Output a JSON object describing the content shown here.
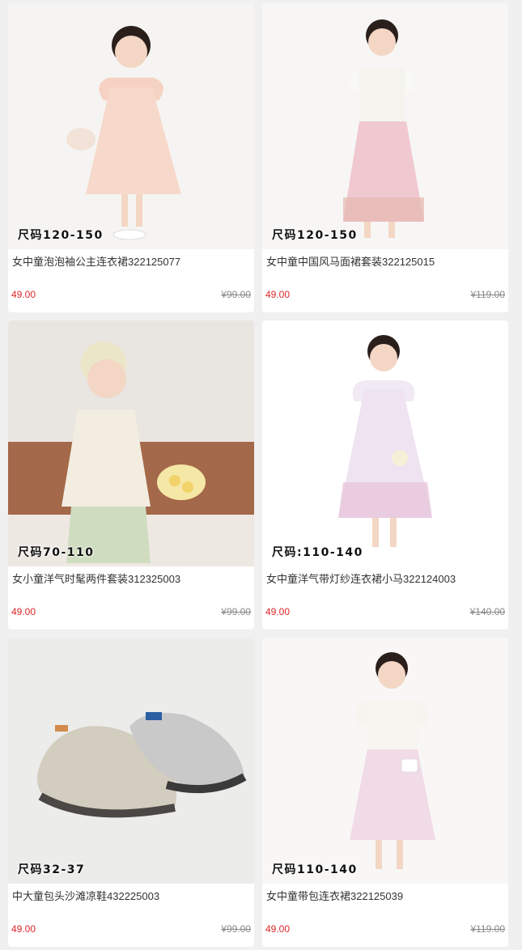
{
  "products": [
    {
      "title": "女中童泡泡袖公主连衣裙322125077",
      "size": "尺码120-150",
      "price": "49.00",
      "original_price": "¥99.00",
      "image": "girl in pink puff sleeve dress"
    },
    {
      "title": "女中童中国风马面裙套装322125015",
      "size": "尺码120-150",
      "price": "49.00",
      "original_price": "¥119.00",
      "image": "girl in chinese horse-face skirt set"
    },
    {
      "title": "女小童洋气时髦两件套装312325003",
      "size": "尺码70-110",
      "price": "49.00",
      "original_price": "¥99.00",
      "image": "toddler in cream two-piece outfit"
    },
    {
      "title": "女中童洋气带灯纱连衣裙小马322124003",
      "size": "尺码:110-140",
      "price": "49.00",
      "original_price": "¥140.00",
      "image": "girl in lavender tulle dress"
    },
    {
      "title": "中大童包头沙滩凉鞋432225003",
      "size": "尺码32-37",
      "price": "49.00",
      "original_price": "¥99.00",
      "image": "pair of closed-toe beach sandals"
    },
    {
      "title": "女中童带包连衣裙322125039",
      "size": "尺码110-140",
      "price": "49.00",
      "original_price": "¥119.00",
      "image": "girl in white top and pink tulle dress"
    }
  ]
}
